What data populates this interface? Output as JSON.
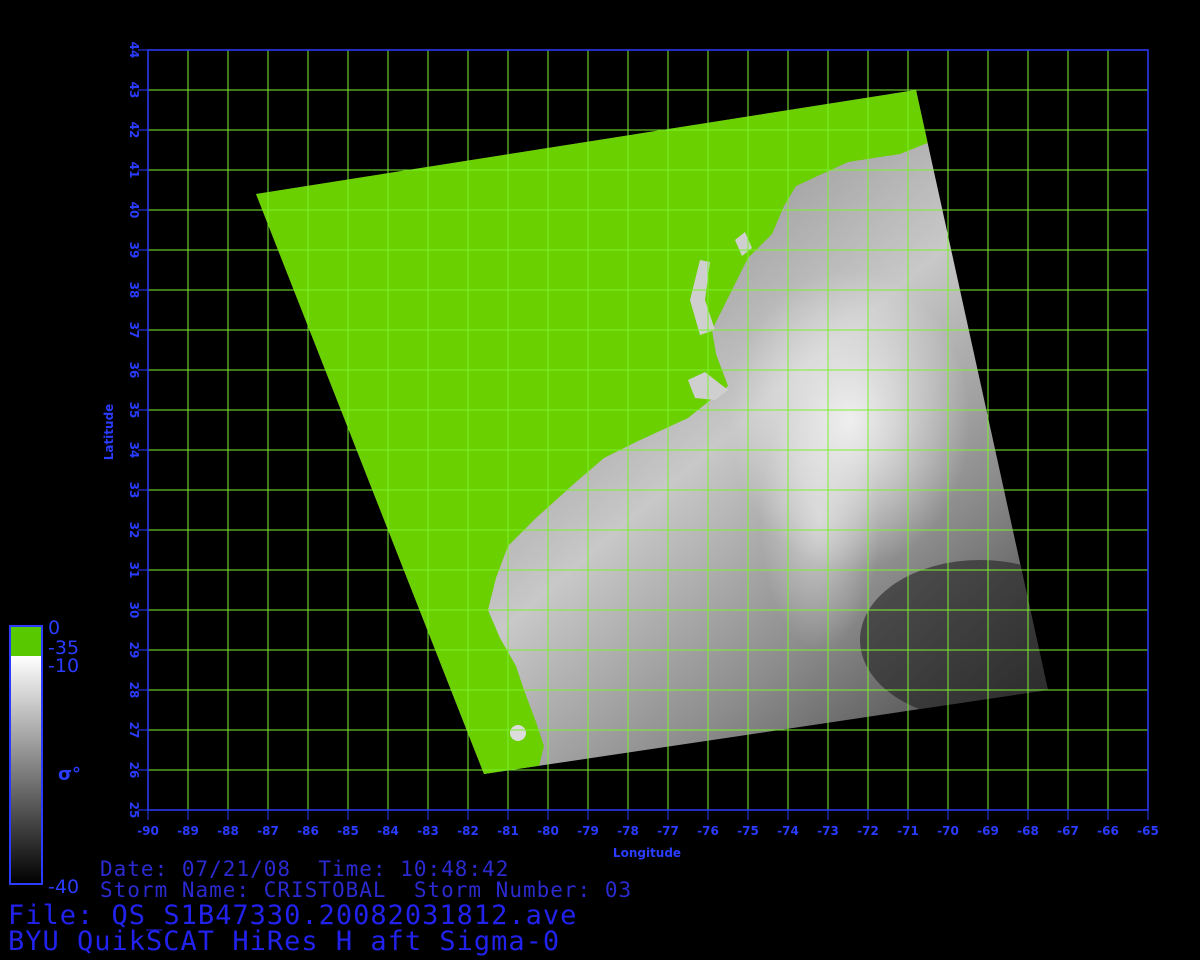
{
  "map": {
    "lon_range": [
      -90,
      -65
    ],
    "lat_range": [
      25,
      44
    ],
    "lon_ticks": [
      "-90",
      "-89",
      "-88",
      "-87",
      "-86",
      "-85",
      "-84",
      "-83",
      "-82",
      "-81",
      "-80",
      "-79",
      "-78",
      "-77",
      "-76",
      "-75",
      "-74",
      "-73",
      "-72",
      "-71",
      "-70",
      "-69",
      "-68",
      "-67",
      "-66",
      "-65"
    ],
    "lat_ticks": [
      "25",
      "26",
      "27",
      "28",
      "29",
      "30",
      "31",
      "32",
      "33",
      "34",
      "35",
      "36",
      "37",
      "38",
      "39",
      "40",
      "41",
      "42",
      "43",
      "44"
    ],
    "xlabel": "Longitude",
    "ylabel": "Latitude",
    "grid": true,
    "colors": {
      "frame": "#2a3cff",
      "grid": "#7cf030",
      "land": "#6ad000",
      "axis_text": "#2a3cff"
    },
    "swath_corners_lonlat": [
      [
        -87.3,
        40.4
      ],
      [
        -70.8,
        43.0
      ],
      [
        -67.5,
        28.0
      ],
      [
        -81.6,
        25.9
      ]
    ]
  },
  "colorbar": {
    "label": "σ°",
    "top_value": "0",
    "land_value": "-35",
    "upper_value": "-10",
    "bottom_value": "-40",
    "colors": {
      "land": "#58c800",
      "high": "#ffffff",
      "low": "#000000",
      "border": "#2a3cff"
    }
  },
  "info": {
    "date_label": "Date:",
    "date": "07/21/08",
    "time_label": "Time:",
    "time": "10:48:42",
    "storm_name_label": "Storm Name:",
    "storm_name": "CRISTOBAL",
    "storm_number_label": "Storm Number:",
    "storm_number": "03",
    "file_label": "File:",
    "file": "QS_S1B47330.20082031812.ave",
    "product": "BYU QuikSCAT HiRes H aft Sigma-0"
  }
}
